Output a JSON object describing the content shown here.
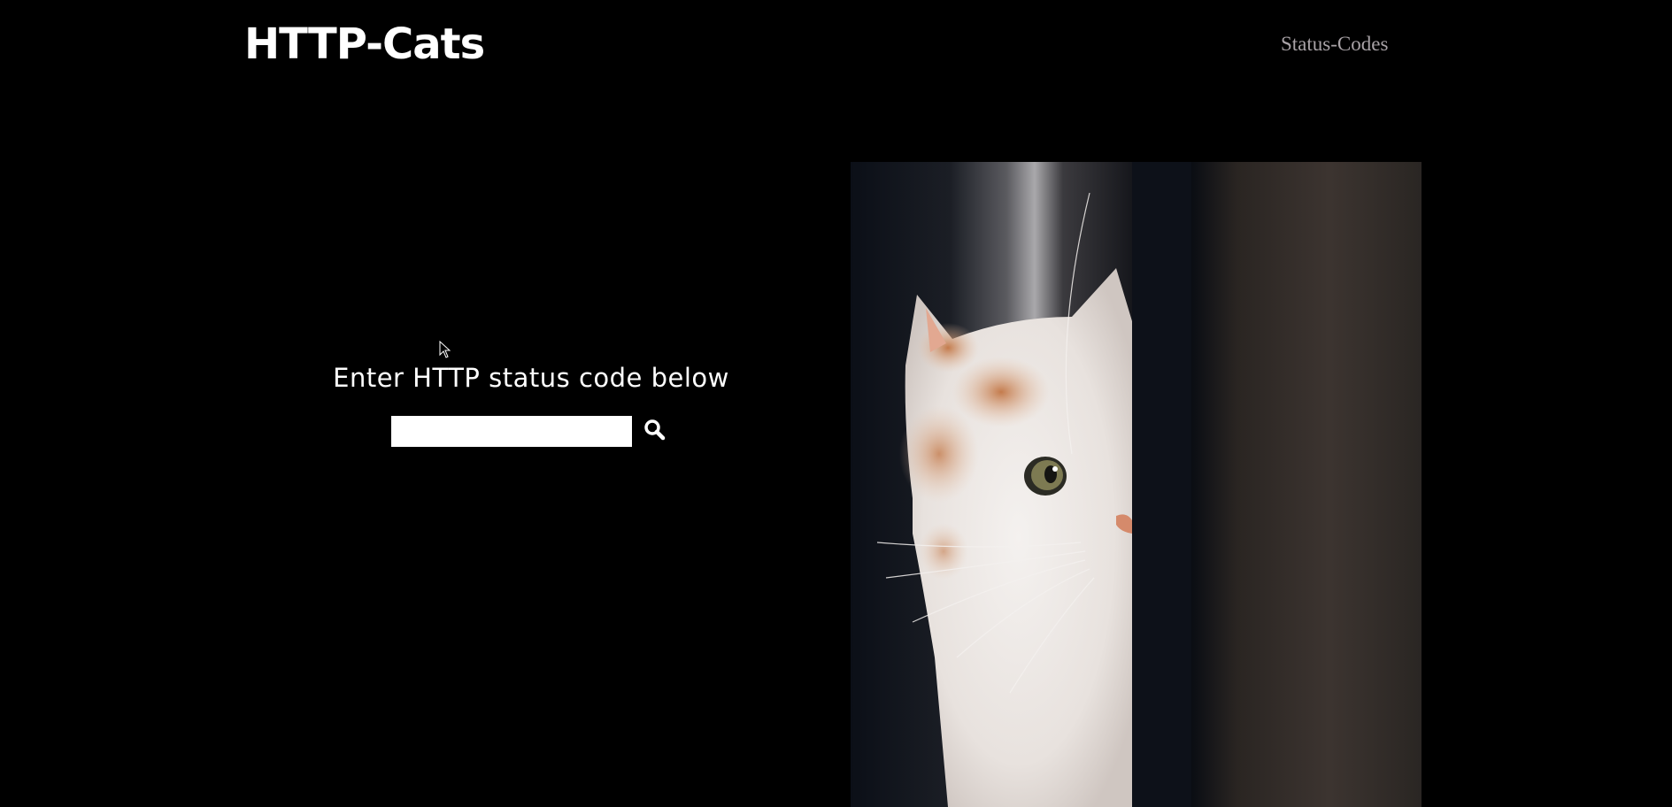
{
  "header": {
    "brand": "HTTP-Cats",
    "nav_link": "Status-Codes"
  },
  "search": {
    "heading": "Enter HTTP status code below",
    "input_value": "",
    "placeholder": "",
    "button_icon": "search-icon"
  },
  "hero_image": {
    "subject": "white-and-orange kitten peeking around a doorway",
    "icon": "cat-photo"
  },
  "colors": {
    "background": "#000000",
    "text": "#ffffff",
    "nav_link": "#a8a2a6"
  }
}
